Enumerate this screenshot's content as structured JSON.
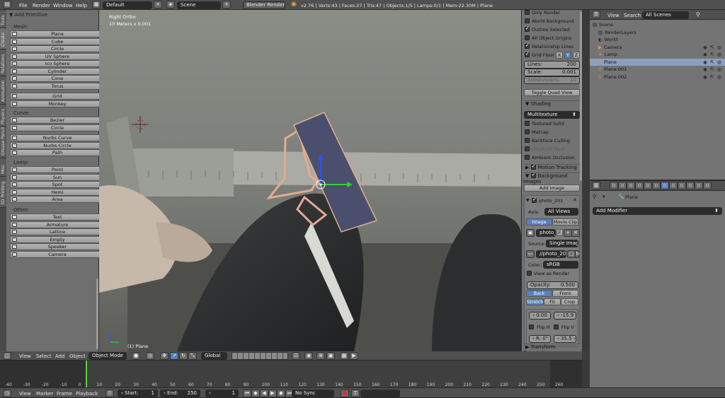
{
  "topbar": {
    "menus": [
      "File",
      "Render",
      "Window",
      "Help"
    ],
    "screen_layout": "Default",
    "scene": "Scene",
    "render_engine": "Blender Render",
    "stats": "v2.76 | Verts:43 | Faces:27 | Tris:47 | Objects:1/5 | Lamps:0/1 | Mem:22.30M | Plane"
  },
  "toolshelf": {
    "tabs": [
      "Tools",
      "Create",
      "Relations",
      "Animation",
      "Physics",
      "Grease Pencil",
      "Misc",
      "3D Printing"
    ],
    "panel_title": "Add Primitive",
    "mesh_label": "Mesh:",
    "mesh": [
      "Plane",
      "Cube",
      "Circle",
      "UV Sphere",
      "Ico Sphere",
      "Cylinder",
      "Cone",
      "Torus"
    ],
    "mesh2": [
      "Grid",
      "Monkey"
    ],
    "curve_label": "Curve:",
    "curve": [
      "Bezier",
      "Circle"
    ],
    "curve2": [
      "Nurbs Curve",
      "Nurbs Circle",
      "Path"
    ],
    "lamp_label": "Lamp:",
    "lamp": [
      "Point",
      "Sun",
      "Spot",
      "Hemi",
      "Area"
    ],
    "other_label": "Other:",
    "other": [
      "Text",
      "Armature",
      "Lattice",
      "Empty",
      "Speaker",
      "Camera"
    ]
  },
  "viewport": {
    "view_name": "Right Ortho",
    "scale": "10 Meters x 0.001",
    "object_label": "(1) Plane"
  },
  "npanel": {
    "display": [
      {
        "label": "Only Render",
        "checked": false
      },
      {
        "label": "World Background",
        "checked": false
      },
      {
        "label": "Outline Selected",
        "checked": true
      },
      {
        "label": "All Object Origins",
        "checked": false
      },
      {
        "label": "Relationship Lines",
        "checked": true
      }
    ],
    "grid_floor": "Grid Floor",
    "axes": [
      "X",
      "Y",
      "Z"
    ],
    "lines_label": "Lines:",
    "lines_value": "200",
    "scale_label": "Scale:",
    "scale_value": "0.001",
    "subdiv_label": "Subdivisions:",
    "subdiv_value": "10",
    "toggle_quad": "Toggle Quad View",
    "shading_title": "Shading",
    "shading_mode": "Multitexture",
    "shading_opts": [
      {
        "label": "Textured Solid",
        "checked": false
      },
      {
        "label": "Matcap",
        "checked": false
      },
      {
        "label": "Backface Culling",
        "checked": false
      },
      {
        "label": "Depth Of Field",
        "checked": false
      },
      {
        "label": "Ambient Occlusion",
        "checked": false
      }
    ],
    "motion_tracking": "Motion Tracking",
    "bg_images": "Background Images",
    "add_image": "Add Image",
    "image_name": "photo_201",
    "axis_label": "Axis:",
    "axis_value": "All Views",
    "source_tabs": [
      "Image",
      "Movie Clip"
    ],
    "image_field": "photo_",
    "image_field_f": "F",
    "source_label": "Source:",
    "source_value": "Single Image",
    "file_path": "//photo_20...",
    "color_label": "Color:",
    "color_value": "sRGB",
    "view_as_render": "View as Render",
    "opacity_label": "Opacity:",
    "opacity_value": "0.500",
    "front_back": [
      "Back",
      "Front"
    ],
    "fit_modes": [
      "Stretch",
      "Fit",
      "Crop"
    ],
    "x_value": "0.00",
    "y_value": "-15.9",
    "flip_x": "Flip H",
    "flip_y": "Flip V",
    "rot_value": "R: 0°",
    "size_value": "35.5",
    "transform_orient": "Transform Orientations"
  },
  "outliner": {
    "menus": [
      "View",
      "Search"
    ],
    "filter": "All Scenes",
    "rows": [
      {
        "label": "Scene",
        "indent": 0,
        "selected": false
      },
      {
        "label": "RenderLayers",
        "indent": 1,
        "selected": false
      },
      {
        "label": "World",
        "indent": 1,
        "selected": false
      },
      {
        "label": "Camera",
        "indent": 1,
        "selected": false
      },
      {
        "label": "Lamp",
        "indent": 1,
        "selected": false
      },
      {
        "label": "Plane",
        "indent": 1,
        "selected": true
      },
      {
        "label": "Plane.001",
        "indent": 1,
        "selected": false
      },
      {
        "label": "Plane.002",
        "indent": 1,
        "selected": false
      }
    ]
  },
  "properties": {
    "object_name": "Plane",
    "add_modifier": "Add Modifier"
  },
  "view3d_header": {
    "menus": [
      "View",
      "Select",
      "Add",
      "Object"
    ],
    "mode": "Object Mode",
    "orientation": "Global"
  },
  "timeline": {
    "ruler": [
      "-40",
      "-30",
      "-20",
      "-10",
      "0",
      "10",
      "20",
      "30",
      "40",
      "50",
      "60",
      "70",
      "80",
      "90",
      "100",
      "110",
      "120",
      "130",
      "140",
      "150",
      "160",
      "170",
      "180",
      "190",
      "200",
      "210",
      "220",
      "230",
      "240",
      "250",
      "260"
    ],
    "menus": [
      "View",
      "Marker",
      "Frame",
      "Playback"
    ],
    "start_label": "Start:",
    "start_value": "1",
    "end_label": "End:",
    "end_value": "250",
    "current_frame": "1",
    "sync": "No Sync"
  },
  "colors": {
    "accent_blue": "#5680c2",
    "selection": "#8aa0bd",
    "object_face": "#4a4f6e",
    "outline": "#e4ab8f"
  }
}
